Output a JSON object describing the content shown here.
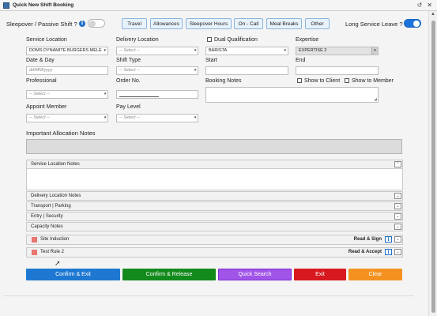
{
  "window": {
    "title": "Quick New Shift Booking",
    "controls": [
      "↺",
      "✕"
    ]
  },
  "toprow": {
    "sleepover_label": "Sleepover / Passive Shift ?",
    "sleepover_on": false,
    "long_service_label": "Long Service Leave ?",
    "long_service_on": true,
    "tabs": [
      "Travel",
      "Allowances",
      "Sleepover Hours",
      "On - Call",
      "Meal Breaks",
      "Other"
    ]
  },
  "form": {
    "service_location": {
      "label": "Service Location",
      "value": "DOMS DYNAMITE BURGERS MELE"
    },
    "delivery_location": {
      "label": "Delivery Location",
      "value": "-- Select --"
    },
    "dual_qualification": {
      "label": "Dual Qualification",
      "checked": false,
      "value": "BARISTA"
    },
    "expertise": {
      "label": "Expertise",
      "value": "EXPERTISE 2"
    },
    "date_day": {
      "label": "Date & Day",
      "placeholder": "dd/MM/yyyy"
    },
    "shift_type": {
      "label": "Shift Type",
      "value": "-- Select --"
    },
    "start": {
      "label": "Start",
      "value": ""
    },
    "end": {
      "label": "End",
      "value": ""
    },
    "professional": {
      "label": "Professional",
      "value": "-- Select --"
    },
    "order_no": {
      "label": "Order No.",
      "value": ""
    },
    "booking_notes": {
      "label": "Booking Notes"
    },
    "show_to_client": {
      "label": "Show to Client",
      "checked": false
    },
    "show_to_member": {
      "label": "Show to Member",
      "checked": false
    },
    "appoint_member": {
      "label": "Appoint Member",
      "value": "-- Select --"
    },
    "pay_level": {
      "label": "Pay Level",
      "value": "-- Select --"
    },
    "important_alloc_notes": {
      "label": "Important Allocation Notes"
    }
  },
  "accordions": [
    {
      "label": "Service Location Notes",
      "expanded": true,
      "chevron": "⌃"
    },
    {
      "label": "Delivery Location Notes",
      "chevron": "⌄"
    },
    {
      "label": "Transport | Parking",
      "chevron": "⌄"
    },
    {
      "label": "Entry | Security",
      "chevron": "⌄"
    },
    {
      "label": "Capacity Notes",
      "chevron": "⌄"
    }
  ],
  "rules": [
    {
      "label": "Site Induction",
      "action": "Read & Sign",
      "color": "#e8766f"
    },
    {
      "label": "Test Rule 2",
      "action": "Read & Accept",
      "color": "#e8766f"
    }
  ],
  "actions": [
    {
      "label": "Confirm & Exit",
      "color": "#1e78d1"
    },
    {
      "label": "Confirm & Release",
      "color": "#128a1c"
    },
    {
      "label": "Quick Search",
      "color": "#a154e8"
    },
    {
      "label": "Exit",
      "color": "#d7191f"
    },
    {
      "label": "Clear",
      "color": "#f39220"
    }
  ],
  "icons": {
    "info": "i",
    "select_arrow": "▾",
    "resize": "◢"
  }
}
